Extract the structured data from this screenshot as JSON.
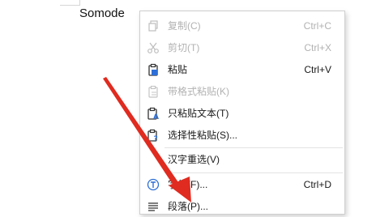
{
  "document": {
    "text": "Somode"
  },
  "menu": {
    "copy": {
      "label": "复制(C)",
      "shortcut": "Ctrl+C",
      "icon": "copy-icon"
    },
    "cut": {
      "label": "剪切(T)",
      "shortcut": "Ctrl+X",
      "icon": "scissors-icon"
    },
    "paste": {
      "label": "粘贴",
      "shortcut": "Ctrl+V",
      "icon": "clipboard-icon"
    },
    "paste_with_format": {
      "label": "带格式粘贴(K)",
      "icon": "clipboard-format-icon"
    },
    "paste_text_only": {
      "label": "只粘贴文本(T)",
      "icon": "clipboard-text-icon"
    },
    "paste_special": {
      "label": "选择性粘贴(S)...",
      "icon": "clipboard-question-icon"
    },
    "reselect_chars": {
      "label": "汉字重选(V)"
    },
    "font": {
      "label": "字体(F)...",
      "shortcut": "Ctrl+D",
      "icon": "font-t-icon"
    },
    "paragraph": {
      "label": "段落(P)...",
      "icon": "paragraph-lines-icon"
    }
  },
  "colors": {
    "arrow": "#e02b20",
    "disabled_text": "#b2b2b2"
  }
}
